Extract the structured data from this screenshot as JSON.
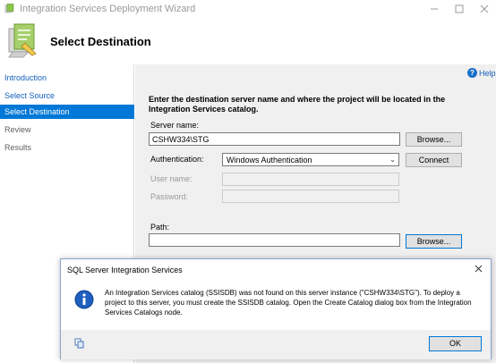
{
  "window": {
    "title": "Integration Services Deployment Wizard"
  },
  "header": {
    "title": "Select Destination"
  },
  "sidebar": {
    "items": [
      {
        "label": "Introduction",
        "state": "link"
      },
      {
        "label": "Select Source",
        "state": "link"
      },
      {
        "label": "Select Destination",
        "state": "selected"
      },
      {
        "label": "Review",
        "state": "disabled"
      },
      {
        "label": "Results",
        "state": "disabled"
      }
    ]
  },
  "help": {
    "label": "Help"
  },
  "form": {
    "instructions": "Enter the destination server name and where the project will be located in the Integration Services catalog.",
    "server_label": "Server name:",
    "server_value": "CSHW334\\STG",
    "browse_label": "Browse...",
    "auth_label": "Authentication:",
    "auth_value": "Windows Authentication",
    "connect_label": "Connect",
    "user_label": "User name:",
    "password_label": "Password:",
    "path_label": "Path:",
    "path_value": "",
    "browse2_label": "Browse..."
  },
  "dialog": {
    "title": "SQL Server Integration Services",
    "message": "An Integration Services catalog (SSISDB) was not found on this server instance (\"CSHW334\\STG\"). To deploy a project to this server, you must create the SSISDB catalog. Open the Create Catalog dialog box from the Integration Services Catalogs node.",
    "ok_label": "OK"
  },
  "colors": {
    "selection": "#0078d7",
    "link": "#1560bd"
  }
}
